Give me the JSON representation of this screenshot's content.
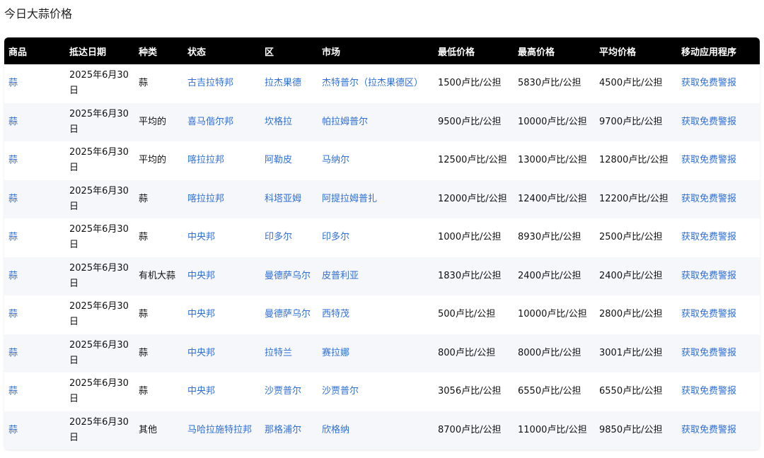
{
  "page": {
    "title": "今日大蒜价格"
  },
  "table": {
    "headers": [
      "商品",
      "抵达日期",
      "种类",
      "状态",
      "区",
      "市场",
      "最低价格",
      "最高价格",
      "平均价格",
      "移动应用程序"
    ],
    "rows": [
      {
        "commodity": "蒜",
        "date": "2025年6月30日",
        "variety": "蒜",
        "state": "古吉拉特邦",
        "district": "拉杰果德",
        "market": "杰特普尔（拉杰果德区）",
        "min": "1500卢比/公担",
        "max": "5830卢比/公担",
        "avg": "4500卢比/公担",
        "app": "获取免费警报"
      },
      {
        "commodity": "蒜",
        "date": "2025年6月30日",
        "variety": "平均的",
        "state": "喜马偕尔邦",
        "district": "坎格拉",
        "market": "帕拉姆普尔",
        "min": "9500卢比/公担",
        "max": "10000卢比/公担",
        "avg": "9700卢比/公担",
        "app": "获取免费警报"
      },
      {
        "commodity": "蒜",
        "date": "2025年6月30日",
        "variety": "平均的",
        "state": "喀拉拉邦",
        "district": "阿勒皮",
        "market": "马纳尔",
        "min": "12500卢比/公担",
        "max": "13000卢比/公担",
        "avg": "12800卢比/公担",
        "app": "获取免费警报"
      },
      {
        "commodity": "蒜",
        "date": "2025年6月30日",
        "variety": "蒜",
        "state": "喀拉拉邦",
        "district": "科塔亚姆",
        "market": "阿提拉姆普扎",
        "min": "12000卢比/公担",
        "max": "12400卢比/公担",
        "avg": "12200卢比/公担",
        "app": "获取免费警报"
      },
      {
        "commodity": "蒜",
        "date": "2025年6月30日",
        "variety": "蒜",
        "state": "中央邦",
        "district": "印多尔",
        "market": "印多尔",
        "min": "1000卢比/公担",
        "max": "8930卢比/公担",
        "avg": "2500卢比/公担",
        "app": "获取免费警报"
      },
      {
        "commodity": "蒜",
        "date": "2025年6月30日",
        "variety": "有机大蒜",
        "state": "中央邦",
        "district": "曼德萨乌尔",
        "market": "皮普利亚",
        "min": "1830卢比/公担",
        "max": "2400卢比/公担",
        "avg": "2400卢比/公担",
        "app": "获取免费警报"
      },
      {
        "commodity": "蒜",
        "date": "2025年6月30日",
        "variety": "蒜",
        "state": "中央邦",
        "district": "曼德萨乌尔",
        "market": "西特茂",
        "min": "500卢比/公担",
        "max": "10000卢比/公担",
        "avg": "2800卢比/公担",
        "app": "获取免费警报"
      },
      {
        "commodity": "蒜",
        "date": "2025年6月30日",
        "variety": "蒜",
        "state": "中央邦",
        "district": "拉特兰",
        "market": "赛拉娜",
        "min": "800卢比/公担",
        "max": "8000卢比/公担",
        "avg": "3001卢比/公担",
        "app": "获取免费警报"
      },
      {
        "commodity": "蒜",
        "date": "2025年6月30日",
        "variety": "蒜",
        "state": "中央邦",
        "district": "沙贾普尔",
        "market": "沙贾普尔",
        "min": "3056卢比/公担",
        "max": "6550卢比/公担",
        "avg": "6550卢比/公担",
        "app": "获取免费警报"
      },
      {
        "commodity": "蒜",
        "date": "2025年6月30日",
        "variety": "其他",
        "state": "马哈拉施特拉邦",
        "district": "那格浦尔",
        "market": "欣格纳",
        "min": "8700卢比/公担",
        "max": "11000卢比/公担",
        "avg": "9850卢比/公担",
        "app": "获取免费警报"
      }
    ]
  },
  "colors": {
    "link": "#2f6fd6",
    "header_bg": "#000000",
    "row_alt": "#f6f7fb"
  }
}
